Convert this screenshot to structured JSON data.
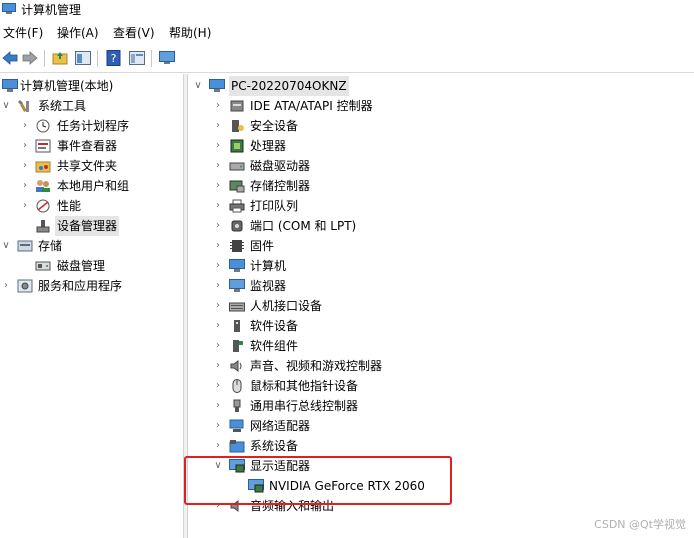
{
  "window": {
    "title": "计算机管理"
  },
  "menu": [
    "文件(F)",
    "操作(A)",
    "查看(V)",
    "帮助(H)"
  ],
  "toolbar": {
    "buttons": [
      "back-icon",
      "forward-icon",
      "up-folder-icon",
      "show-tree-icon",
      "help-icon",
      "properties-icon",
      "monitor-icon"
    ]
  },
  "left_tree": {
    "root": "计算机管理(本地)",
    "system_tools": "系统工具",
    "task_scheduler": "任务计划程序",
    "event_viewer": "事件查看器",
    "shared_folders": "共享文件夹",
    "local_users": "本地用户和组",
    "performance": "性能",
    "device_manager": "设备管理器",
    "storage": "存储",
    "disk_management": "磁盘管理",
    "services_apps": "服务和应用程序"
  },
  "right_tree": {
    "computer_name": "PC-20220704OKNZ",
    "categories": [
      "IDE ATA/ATAPI 控制器",
      "安全设备",
      "处理器",
      "磁盘驱动器",
      "存储控制器",
      "打印队列",
      "端口 (COM 和 LPT)",
      "固件",
      "计算机",
      "监视器",
      "人机接口设备",
      "软件设备",
      "软件组件",
      "声音、视频和游戏控制器",
      "鼠标和其他指针设备",
      "通用串行总线控制器",
      "网络适配器",
      "系统设备",
      "显示适配器"
    ],
    "display_adapter_child": "NVIDIA GeForce RTX 2060",
    "after": "音频输入和输出"
  },
  "watermark": "CSDN @Qt学视觉",
  "colors": {
    "highlight": "#e02020",
    "selection": "#e5e5e5"
  }
}
